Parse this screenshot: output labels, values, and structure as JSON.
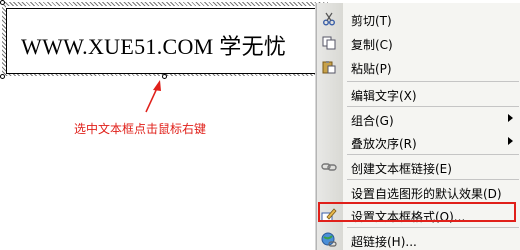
{
  "textbox": {
    "content": "WWW.XUE51.COM  学无忧"
  },
  "annotation": {
    "text": "选中文本框点击鼠标右键"
  },
  "context_menu": {
    "items": [
      {
        "label": "剪切(T)",
        "icon": "scissors-icon",
        "submenu": false
      },
      {
        "label": "复制(C)",
        "icon": "copy-icon",
        "submenu": false
      },
      {
        "label": "粘贴(P)",
        "icon": "paste-icon",
        "submenu": false
      },
      {
        "label": "编辑文字(X)",
        "icon": "",
        "submenu": false
      },
      {
        "label": "组合(G)",
        "icon": "",
        "submenu": true
      },
      {
        "label": "叠放次序(R)",
        "icon": "",
        "submenu": true
      },
      {
        "label": "创建文本框链接(E)",
        "icon": "link-chain-icon",
        "submenu": false
      },
      {
        "label": "设置自选图形的默认效果(D)",
        "icon": "",
        "submenu": false
      },
      {
        "label": "设置文本框格式(O)...",
        "icon": "format-textbox-icon",
        "submenu": false,
        "highlighted": true
      },
      {
        "label": "超链接(H)...",
        "icon": "hyperlink-globe-icon",
        "submenu": false
      }
    ]
  },
  "colors": {
    "annotation_red": "#e0201a",
    "menu_background": "#f5f5f2"
  }
}
